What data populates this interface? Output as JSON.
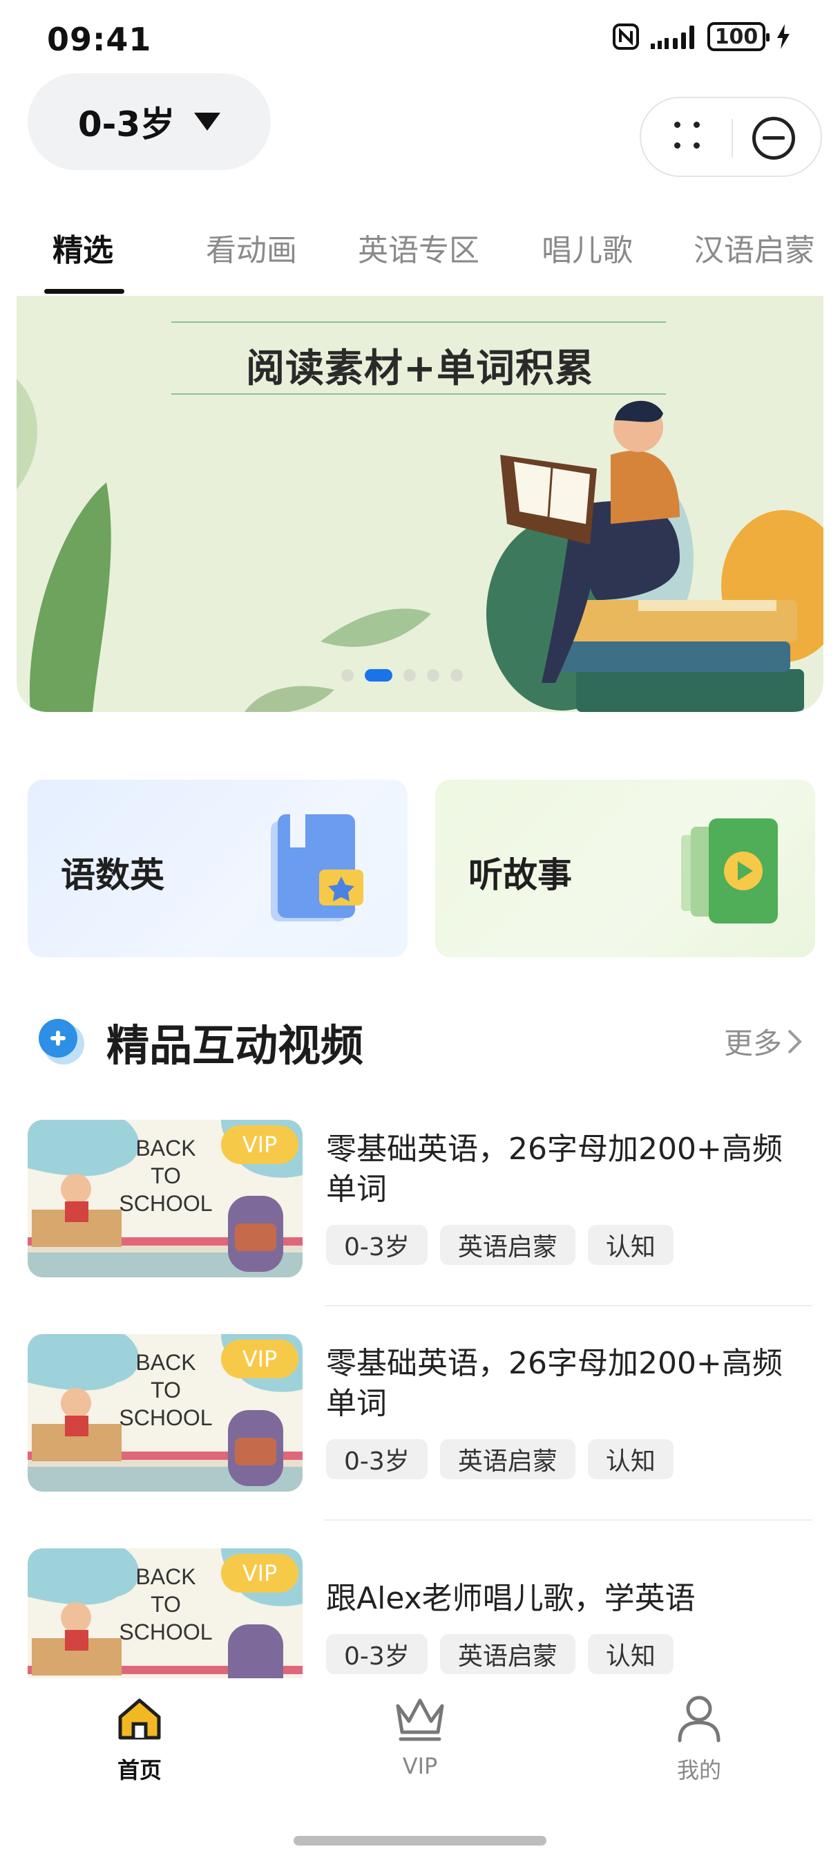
{
  "status_bar": {
    "time": "09:41",
    "battery": "100"
  },
  "header": {
    "age_selector": "0-3岁"
  },
  "tabs": [
    {
      "label": "精选",
      "active": true
    },
    {
      "label": "看动画",
      "active": false
    },
    {
      "label": "英语专区",
      "active": false
    },
    {
      "label": "唱儿歌",
      "active": false
    },
    {
      "label": "汉语启蒙",
      "active": false
    }
  ],
  "banner": {
    "title": "阅读素材+单词积累",
    "active_dot": 1,
    "dot_count": 6
  },
  "categories": [
    {
      "label": "语数英",
      "icon": "book-star-icon"
    },
    {
      "label": "听故事",
      "icon": "play-card-icon"
    }
  ],
  "section": {
    "title": "精品互动视频",
    "more": "更多"
  },
  "videos": [
    {
      "title": "零基础英语，26字母加200+高频单词",
      "badge": "VIP",
      "thumb_text": [
        "BACK",
        "TO",
        "SCHOOL"
      ],
      "tags": [
        "0-3岁",
        "英语启蒙",
        "认知"
      ]
    },
    {
      "title": "零基础英语，26字母加200+高频单词",
      "badge": "VIP",
      "thumb_text": [
        "BACK",
        "TO",
        "SCHOOL"
      ],
      "tags": [
        "0-3岁",
        "英语启蒙",
        "认知"
      ]
    },
    {
      "title": "跟Alex老师唱儿歌，学英语",
      "badge": "VIP",
      "thumb_text": [
        "BACK",
        "TO",
        "SCHOOL"
      ],
      "tags": [
        "0-3岁",
        "英语启蒙",
        "认知"
      ]
    }
  ],
  "tabbar": [
    {
      "label": "首页",
      "icon": "home-icon",
      "active": true
    },
    {
      "label": "VIP",
      "icon": "crown-icon",
      "active": false
    },
    {
      "label": "我的",
      "icon": "person-icon",
      "active": false
    }
  ],
  "colors": {
    "accent": "#1a73e8",
    "vip": "#f7c948",
    "home_active": "#f2b824"
  }
}
